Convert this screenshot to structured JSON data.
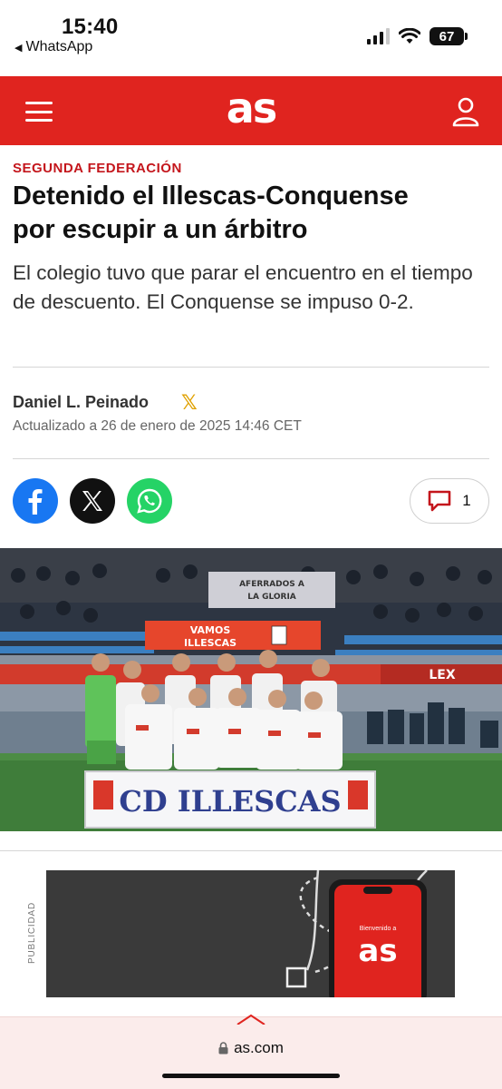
{
  "status_bar": {
    "time": "15:40",
    "back_app": "WhatsApp",
    "battery": "67"
  },
  "header": {
    "logo": "as",
    "menu_icon": "hamburger-menu-icon",
    "user_icon": "user-icon",
    "brand_color": "#e0241f"
  },
  "article": {
    "section": "SEGUNDA FEDERACIÓN",
    "headline_line1": "Detenido el Illescas-Conquense",
    "headline_line2": "por escupir a un árbitro",
    "subhead": "El colegio tuvo que parar el encuentro en el tiempo de descuento. El Conquense se impuso 0-2.",
    "author": "Daniel L. Peinado",
    "author_social_icon": "x-logo-icon",
    "updated": "Actualizado a 26 de enero de 2025 14:46 CET"
  },
  "share": {
    "facebook_icon": "facebook-icon",
    "x_icon": "x-icon",
    "whatsapp_icon": "whatsapp-icon",
    "comment_count": "1"
  },
  "photo": {
    "banner_top_line1": "VAMOS",
    "banner_top_line2": "ILLESCAS",
    "board": "CD ILLESCAS",
    "fan_banner": "AFERRADOS A LA GLORIA",
    "sponsor": "LEX"
  },
  "ad": {
    "label": "PUBLICIDAD",
    "phone_text": "Bienvenido a",
    "phone_logo": "as"
  },
  "browser": {
    "url": "as.com"
  }
}
